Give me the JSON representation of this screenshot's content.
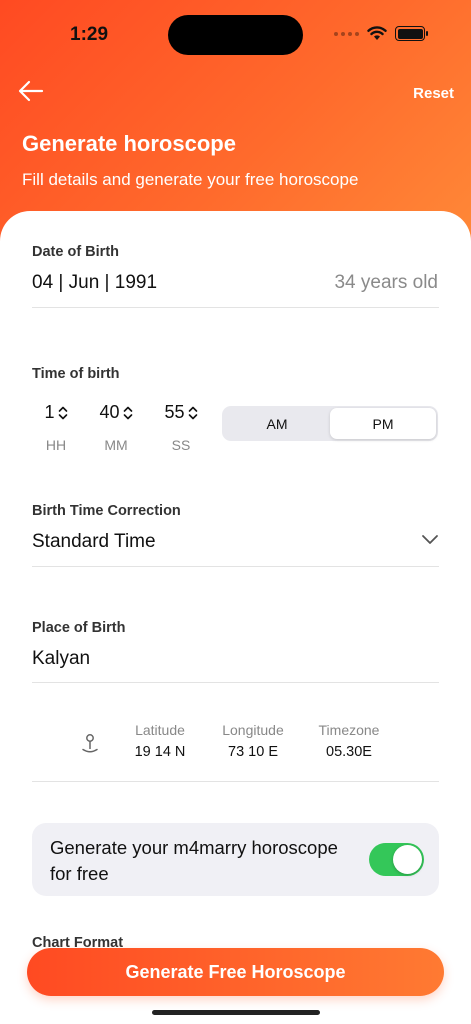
{
  "status_bar": {
    "time": "1:29"
  },
  "header": {
    "reset_label": "Reset",
    "title": "Generate horoscope",
    "subtitle": "Fill details and generate your free horoscope"
  },
  "dob": {
    "label": "Date of Birth",
    "value": "04 | Jun | 1991",
    "age": "34 years old"
  },
  "tob": {
    "label": "Time of birth",
    "hh": "1",
    "mm": "40",
    "ss": "55",
    "hh_label": "HH",
    "mm_label": "MM",
    "ss_label": "SS",
    "am_label": "AM",
    "pm_label": "PM",
    "selected": "PM"
  },
  "correction": {
    "label": "Birth Time Correction",
    "value": "Standard Time"
  },
  "place": {
    "label": "Place of Birth",
    "value": "Kalyan"
  },
  "geo": {
    "lat_label": "Latitude",
    "lat_value": "19 14 N",
    "lon_label": "Longitude",
    "lon_value": "73 10 E",
    "tz_label": "Timezone",
    "tz_value": "05.30E"
  },
  "toggle": {
    "text": "Generate your m4marry horoscope for free",
    "on": true
  },
  "chart_format": {
    "label": "Chart Format"
  },
  "cta": {
    "label": "Generate Free Horoscope"
  },
  "colors": {
    "accent": "#ff5a28",
    "toggle_on": "#34c759"
  },
  "icons": [
    "back-arrow-icon",
    "wifi-icon",
    "battery-icon",
    "chevron-down-icon",
    "location-pin-icon",
    "up-down-icon"
  ]
}
